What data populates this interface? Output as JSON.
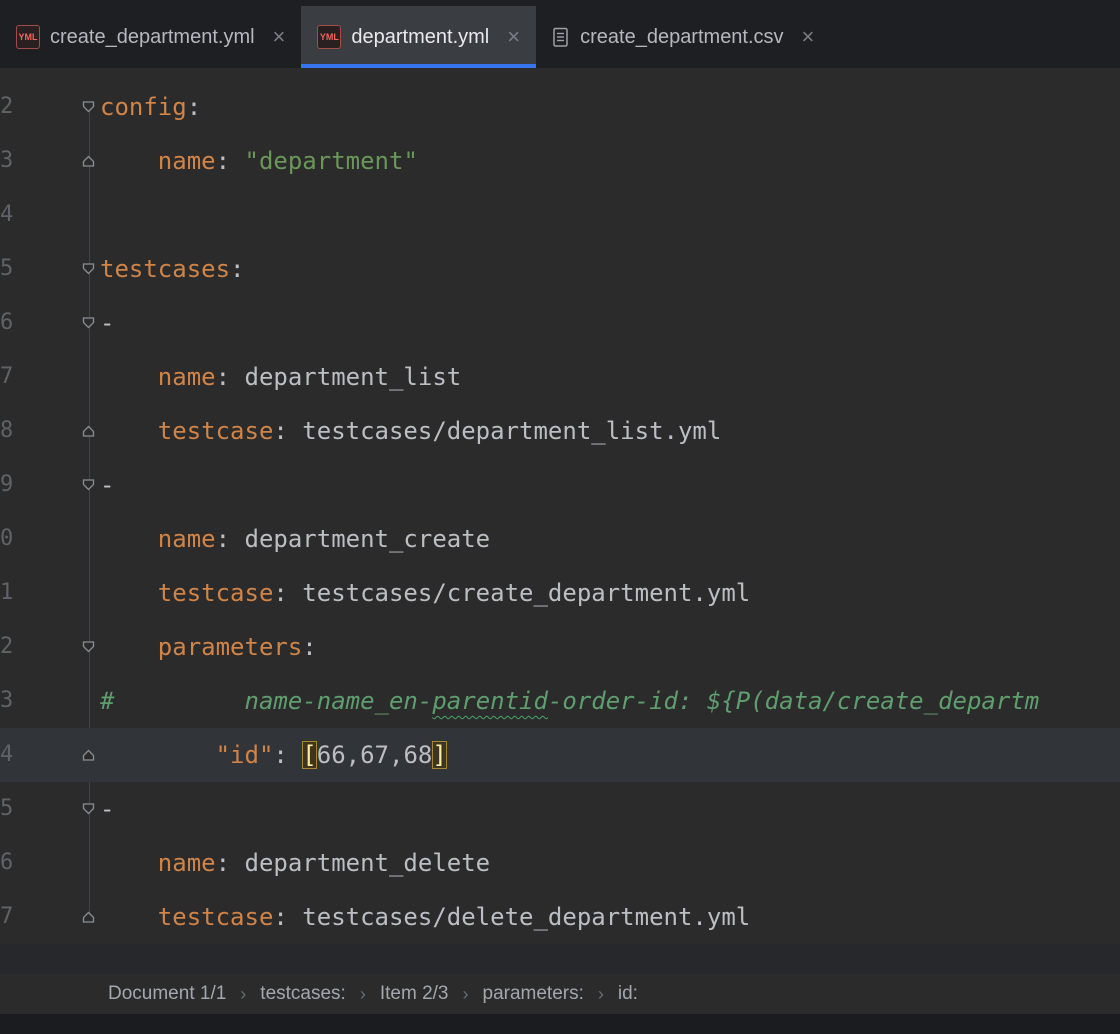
{
  "colors": {
    "accent": "#3674f0",
    "key": "#d08447",
    "string": "#6a9758",
    "comment": "#5f9e6e",
    "text": "#bcbec4",
    "editor_bg": "#2b2b2b",
    "bracket": "#ffec9e",
    "current_line": "#313438",
    "tab_bar_bg": "#1e1f22"
  },
  "icons": {
    "yml_badge_text": "YML"
  },
  "tabs": {
    "close_glyph": "×",
    "items": [
      {
        "label": "create_department.yml",
        "icon": "yml-file-icon",
        "active": false
      },
      {
        "label": "department.yml",
        "icon": "yml-file-icon",
        "active": true
      },
      {
        "label": "create_department.csv",
        "icon": "csv-file-icon",
        "active": false
      }
    ]
  },
  "editor": {
    "lines": [
      {
        "num": "2",
        "fold": "down",
        "seg": [
          {
            "c": "k",
            "t": "config"
          },
          {
            "c": "t",
            "t": ":"
          }
        ]
      },
      {
        "num": "3",
        "fold": "up",
        "seg": [
          {
            "c": "t",
            "t": "    "
          },
          {
            "c": "k",
            "t": "name"
          },
          {
            "c": "t",
            "t": ": "
          },
          {
            "c": "s",
            "t": "\"department\""
          }
        ]
      },
      {
        "num": "4",
        "seg": []
      },
      {
        "num": "5",
        "fold": "down",
        "seg": [
          {
            "c": "k",
            "t": "testcases"
          },
          {
            "c": "t",
            "t": ":"
          }
        ]
      },
      {
        "num": "6",
        "fold": "down",
        "seg": [
          {
            "c": "t",
            "t": "-"
          }
        ]
      },
      {
        "num": "7",
        "seg": [
          {
            "c": "t",
            "t": "    "
          },
          {
            "c": "k",
            "t": "name"
          },
          {
            "c": "t",
            "t": ": department_list"
          }
        ]
      },
      {
        "num": "8",
        "fold": "up",
        "seg": [
          {
            "c": "t",
            "t": "    "
          },
          {
            "c": "k",
            "t": "testcase"
          },
          {
            "c": "t",
            "t": ": testcases/department_list.yml"
          }
        ]
      },
      {
        "num": "9",
        "fold": "down",
        "seg": [
          {
            "c": "t",
            "t": "-"
          }
        ]
      },
      {
        "num": "0",
        "seg": [
          {
            "c": "t",
            "t": "    "
          },
          {
            "c": "k",
            "t": "name"
          },
          {
            "c": "t",
            "t": ": department_create"
          }
        ]
      },
      {
        "num": "1",
        "seg": [
          {
            "c": "t",
            "t": "    "
          },
          {
            "c": "k",
            "t": "testcase"
          },
          {
            "c": "t",
            "t": ": testcases/create_department.yml"
          }
        ]
      },
      {
        "num": "2",
        "fold": "down",
        "seg": [
          {
            "c": "t",
            "t": "    "
          },
          {
            "c": "k",
            "t": "parameters"
          },
          {
            "c": "t",
            "t": ":"
          }
        ]
      },
      {
        "num": "3",
        "seg": [
          {
            "c": "c",
            "t": "#         name-name_en-"
          },
          {
            "c": "cw",
            "t": "parentid"
          },
          {
            "c": "c",
            "t": "-order-id: ${P(data/create_departm"
          }
        ]
      },
      {
        "num": "4",
        "fold": "up",
        "current": true,
        "seg": [
          {
            "c": "t",
            "t": "        "
          },
          {
            "c": "k",
            "t": "\"id\""
          },
          {
            "c": "t",
            "t": ": "
          },
          {
            "c": "br",
            "t": "["
          },
          {
            "c": "t",
            "t": "66,67,68"
          },
          {
            "c": "br",
            "t": "]"
          }
        ]
      },
      {
        "num": "5",
        "fold": "down",
        "seg": [
          {
            "c": "t",
            "t": "-"
          }
        ]
      },
      {
        "num": "6",
        "seg": [
          {
            "c": "t",
            "t": "    "
          },
          {
            "c": "k",
            "t": "name"
          },
          {
            "c": "t",
            "t": ": department_delete"
          }
        ]
      },
      {
        "num": "7",
        "fold": "up",
        "seg": [
          {
            "c": "t",
            "t": "    "
          },
          {
            "c": "k",
            "t": "testcase"
          },
          {
            "c": "t",
            "t": ": testcases/delete_department.yml"
          }
        ]
      }
    ]
  },
  "breadcrumbs": {
    "separator": "›",
    "items": [
      "Document 1/1",
      "testcases:",
      "Item 2/3",
      "parameters:",
      "id:"
    ]
  }
}
